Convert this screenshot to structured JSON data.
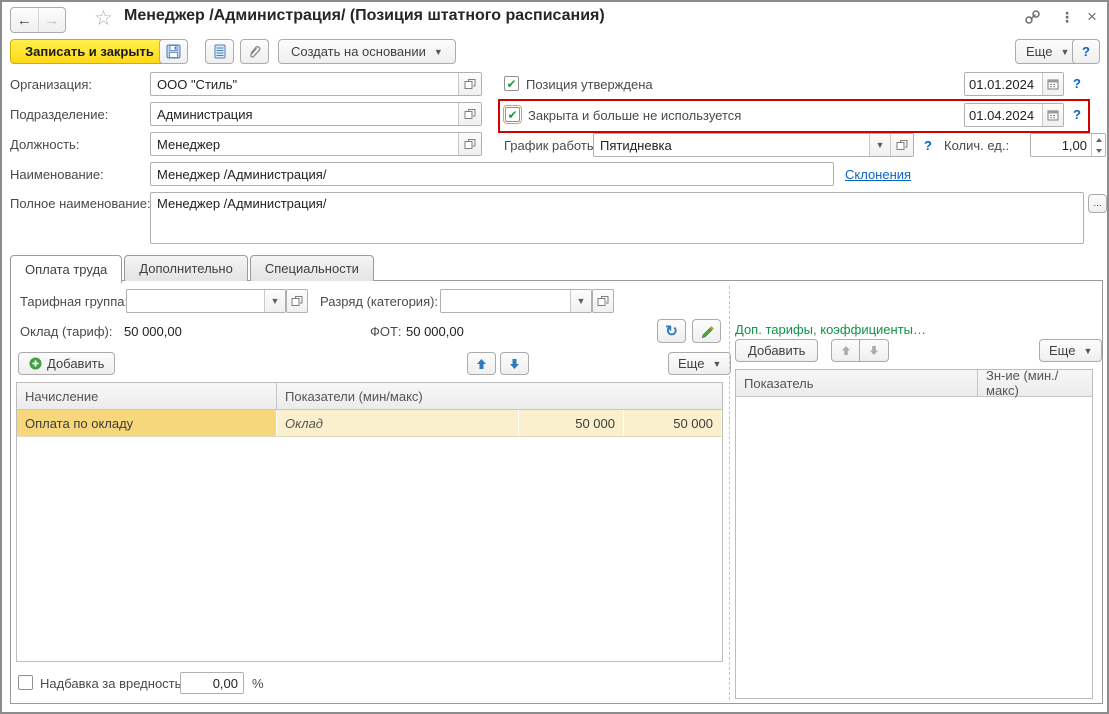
{
  "window": {
    "title": "Менеджер /Администрация/ (Позиция штатного расписания)"
  },
  "toolbar": {
    "save_close": "Записать и закрыть",
    "create_based": "Создать на основании",
    "more": "Еще",
    "help": "?"
  },
  "fields": {
    "organization": {
      "label": "Организация:",
      "value": "ООО \"Стиль\""
    },
    "department": {
      "label": "Подразделение:",
      "value": "Администрация"
    },
    "position": {
      "label": "Должность:",
      "value": "Менеджер"
    },
    "name": {
      "label": "Наименование:",
      "value": "Менеджер /Администрация/"
    },
    "declensions_link": "Склонения",
    "full_name": {
      "label": "Полное наименование:",
      "value": "Менеджер /Администрация/",
      "expand": "..."
    },
    "approved": {
      "label": "Позиция утверждена",
      "date": "01.01.2024",
      "check": "✔"
    },
    "closed": {
      "label": "Закрыта и больше не используется",
      "date": "01.04.2024",
      "check": "✔"
    },
    "schedule": {
      "label": "График работы:",
      "value": "Пятидневка"
    },
    "quantity": {
      "label": "Колич. ед.:",
      "value": "1,00"
    },
    "help_mark": "?"
  },
  "tabs": [
    {
      "label": "Оплата труда"
    },
    {
      "label": "Дополнительно"
    },
    {
      "label": "Специальности"
    }
  ],
  "payroll": {
    "tariff_group_label": "Тарифная группа:",
    "grade_label": "Разряд (категория):",
    "salary_label": "Оклад (тариф):",
    "salary_value": "50 000,00",
    "fot_label": "ФОТ:",
    "fot_value": "50 000,00",
    "add_button": "Добавить",
    "more_button": "Еще",
    "table": {
      "headers": [
        "Начисление",
        "Показатели (мин/макс)"
      ],
      "rows": [
        {
          "accrual": "Оплата по окладу",
          "indicator": "Оклад",
          "min": "50 000",
          "max": "50 000"
        }
      ]
    },
    "hazard": {
      "label": "Надбавка за вредность",
      "value": "0,00",
      "unit": "%"
    }
  },
  "extra_panel": {
    "title": "Доп. тарифы, коэффициенты…",
    "add_button": "Добавить",
    "more_button": "Еще",
    "table_headers": [
      "Показатель",
      "Зн-ие (мин./макс)"
    ]
  },
  "colors": {
    "highlight_red": "#D40000",
    "button_yellow": "#FFD918",
    "link_blue": "#0A64C8",
    "green_text": "#0B9444",
    "row_highlight": "#F6D77B"
  }
}
